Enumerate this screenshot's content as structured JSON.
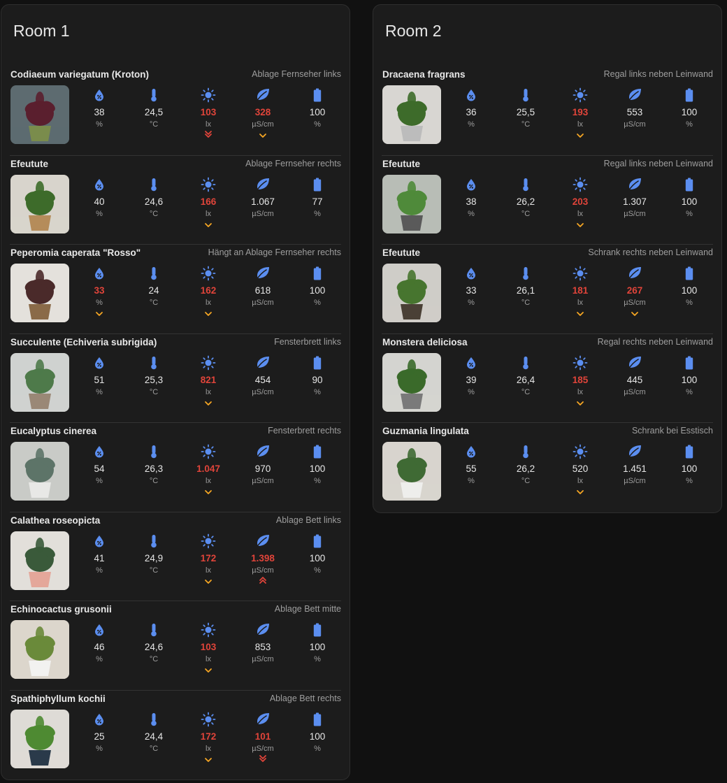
{
  "colors": {
    "icon": "#5b8ef0",
    "alert": "#e0443a",
    "low_indicator": "#f5a623",
    "high_indicator": "#e0443a"
  },
  "units": [
    "%",
    "°C",
    "lx",
    "µS/cm",
    "%"
  ],
  "icons": [
    "moisture-icon",
    "thermometer-icon",
    "sun-icon",
    "leaf-icon",
    "battery-icon"
  ],
  "rooms": [
    {
      "title": "Room 1",
      "plants": [
        {
          "name": "Codiaeum variegatum (Kroton)",
          "location": "Ablage Fernseher links",
          "values": [
            "38",
            "24,5",
            "103",
            "328",
            "100"
          ],
          "alert": [
            false,
            false,
            true,
            true,
            false
          ],
          "indicator": [
            "",
            "",
            "very-low",
            "low",
            ""
          ],
          "photo": {
            "bg": "#5d6b70",
            "pot": "#7a8c4c",
            "leaf": "#5a1f2e"
          }
        },
        {
          "name": "Efeutute",
          "location": "Ablage Fernseher rechts",
          "values": [
            "40",
            "24,6",
            "166",
            "1.067",
            "77"
          ],
          "alert": [
            false,
            false,
            true,
            false,
            false
          ],
          "indicator": [
            "",
            "",
            "low",
            "",
            ""
          ],
          "photo": {
            "bg": "#d8d4cc",
            "pot": "#b58c5a",
            "leaf": "#3d6b2a"
          }
        },
        {
          "name": "Peperomia caperata \"Rosso\"",
          "location": "Hängt an Ablage Fernseher rechts",
          "values": [
            "33",
            "24",
            "162",
            "618",
            "100"
          ],
          "alert": [
            true,
            false,
            true,
            false,
            false
          ],
          "indicator": [
            "low",
            "",
            "low",
            "",
            ""
          ],
          "photo": {
            "bg": "#e4e1dc",
            "pot": "#8a6a48",
            "leaf": "#4a2a2a"
          }
        },
        {
          "name": "Succulente (Echiveria subrigida)",
          "location": "Fensterbrett links",
          "values": [
            "51",
            "25,3",
            "821",
            "454",
            "90"
          ],
          "alert": [
            false,
            false,
            true,
            false,
            false
          ],
          "indicator": [
            "",
            "",
            "low",
            "",
            ""
          ],
          "photo": {
            "bg": "#cfd2d0",
            "pot": "#9a8876",
            "leaf": "#4e7a4a"
          }
        },
        {
          "name": "Eucalyptus cinerea",
          "location": "Fensterbrett rechts",
          "values": [
            "54",
            "26,3",
            "1.047",
            "970",
            "100"
          ],
          "alert": [
            false,
            false,
            true,
            false,
            false
          ],
          "indicator": [
            "",
            "",
            "low",
            "",
            ""
          ],
          "photo": {
            "bg": "#c9cbc7",
            "pot": "#e8e8e6",
            "leaf": "#5d7468"
          }
        },
        {
          "name": "Calathea roseopicta",
          "location": "Ablage Bett links",
          "values": [
            "41",
            "24,9",
            "172",
            "1.398",
            "100"
          ],
          "alert": [
            false,
            false,
            true,
            true,
            false
          ],
          "indicator": [
            "",
            "",
            "low",
            "very-high",
            ""
          ],
          "photo": {
            "bg": "#e2dfda",
            "pot": "#e4a79a",
            "leaf": "#3a5a3a"
          }
        },
        {
          "name": "Echinocactus grusonii",
          "location": "Ablage Bett mitte",
          "values": [
            "46",
            "24,6",
            "103",
            "853",
            "100"
          ],
          "alert": [
            false,
            false,
            true,
            false,
            false
          ],
          "indicator": [
            "",
            "",
            "low",
            "",
            ""
          ],
          "photo": {
            "bg": "#dcd6cc",
            "pot": "#f2f2f0",
            "leaf": "#6a8a3a"
          }
        },
        {
          "name": "Spathiphyllum kochii",
          "location": "Ablage Bett rechts",
          "values": [
            "25",
            "24,4",
            "172",
            "101",
            "100"
          ],
          "alert": [
            false,
            false,
            true,
            true,
            false
          ],
          "indicator": [
            "",
            "",
            "low",
            "very-low",
            ""
          ],
          "photo": {
            "bg": "#dedbd6",
            "pot": "#2a3a4a",
            "leaf": "#4e8a32"
          }
        }
      ]
    },
    {
      "title": "Room 2",
      "plants": [
        {
          "name": "Dracaena fragrans",
          "location": "Regal links neben Leinwand",
          "values": [
            "36",
            "25,5",
            "193",
            "553",
            "100"
          ],
          "alert": [
            false,
            false,
            true,
            false,
            false
          ],
          "indicator": [
            "",
            "",
            "low",
            "",
            ""
          ],
          "photo": {
            "bg": "#d8d6d2",
            "pot": "#bcbcbc",
            "leaf": "#3d6b2a"
          }
        },
        {
          "name": "Efeutute",
          "location": "Regal links neben Leinwand",
          "values": [
            "38",
            "26,2",
            "203",
            "1.307",
            "100"
          ],
          "alert": [
            false,
            false,
            true,
            false,
            false
          ],
          "indicator": [
            "",
            "",
            "low",
            "",
            ""
          ],
          "photo": {
            "bg": "#b8bdb6",
            "pot": "#5a5a5a",
            "leaf": "#4f8a3a"
          }
        },
        {
          "name": "Efeutute",
          "location": "Schrank rechts neben Leinwand",
          "values": [
            "33",
            "26,1",
            "181",
            "267",
            "100"
          ],
          "alert": [
            false,
            false,
            true,
            true,
            false
          ],
          "indicator": [
            "",
            "",
            "low",
            "low",
            ""
          ],
          "photo": {
            "bg": "#cfcdc8",
            "pot": "#4a4036",
            "leaf": "#47752f"
          }
        },
        {
          "name": "Monstera deliciosa",
          "location": "Regal rechts neben Leinwand",
          "values": [
            "39",
            "26,4",
            "185",
            "445",
            "100"
          ],
          "alert": [
            false,
            false,
            true,
            false,
            false
          ],
          "indicator": [
            "",
            "",
            "low",
            "",
            ""
          ],
          "photo": {
            "bg": "#d4d4d0",
            "pot": "#7a7a7a",
            "leaf": "#3a6a2a"
          }
        },
        {
          "name": "Guzmania lingulata",
          "location": "Schrank bei Esstisch",
          "values": [
            "55",
            "26,2",
            "520",
            "1.451",
            "100"
          ],
          "alert": [
            false,
            false,
            false,
            false,
            false
          ],
          "indicator": [
            "",
            "",
            "low",
            "",
            ""
          ],
          "photo": {
            "bg": "#d8d4ce",
            "pot": "#eeeeec",
            "leaf": "#3f6a34"
          }
        }
      ]
    }
  ]
}
